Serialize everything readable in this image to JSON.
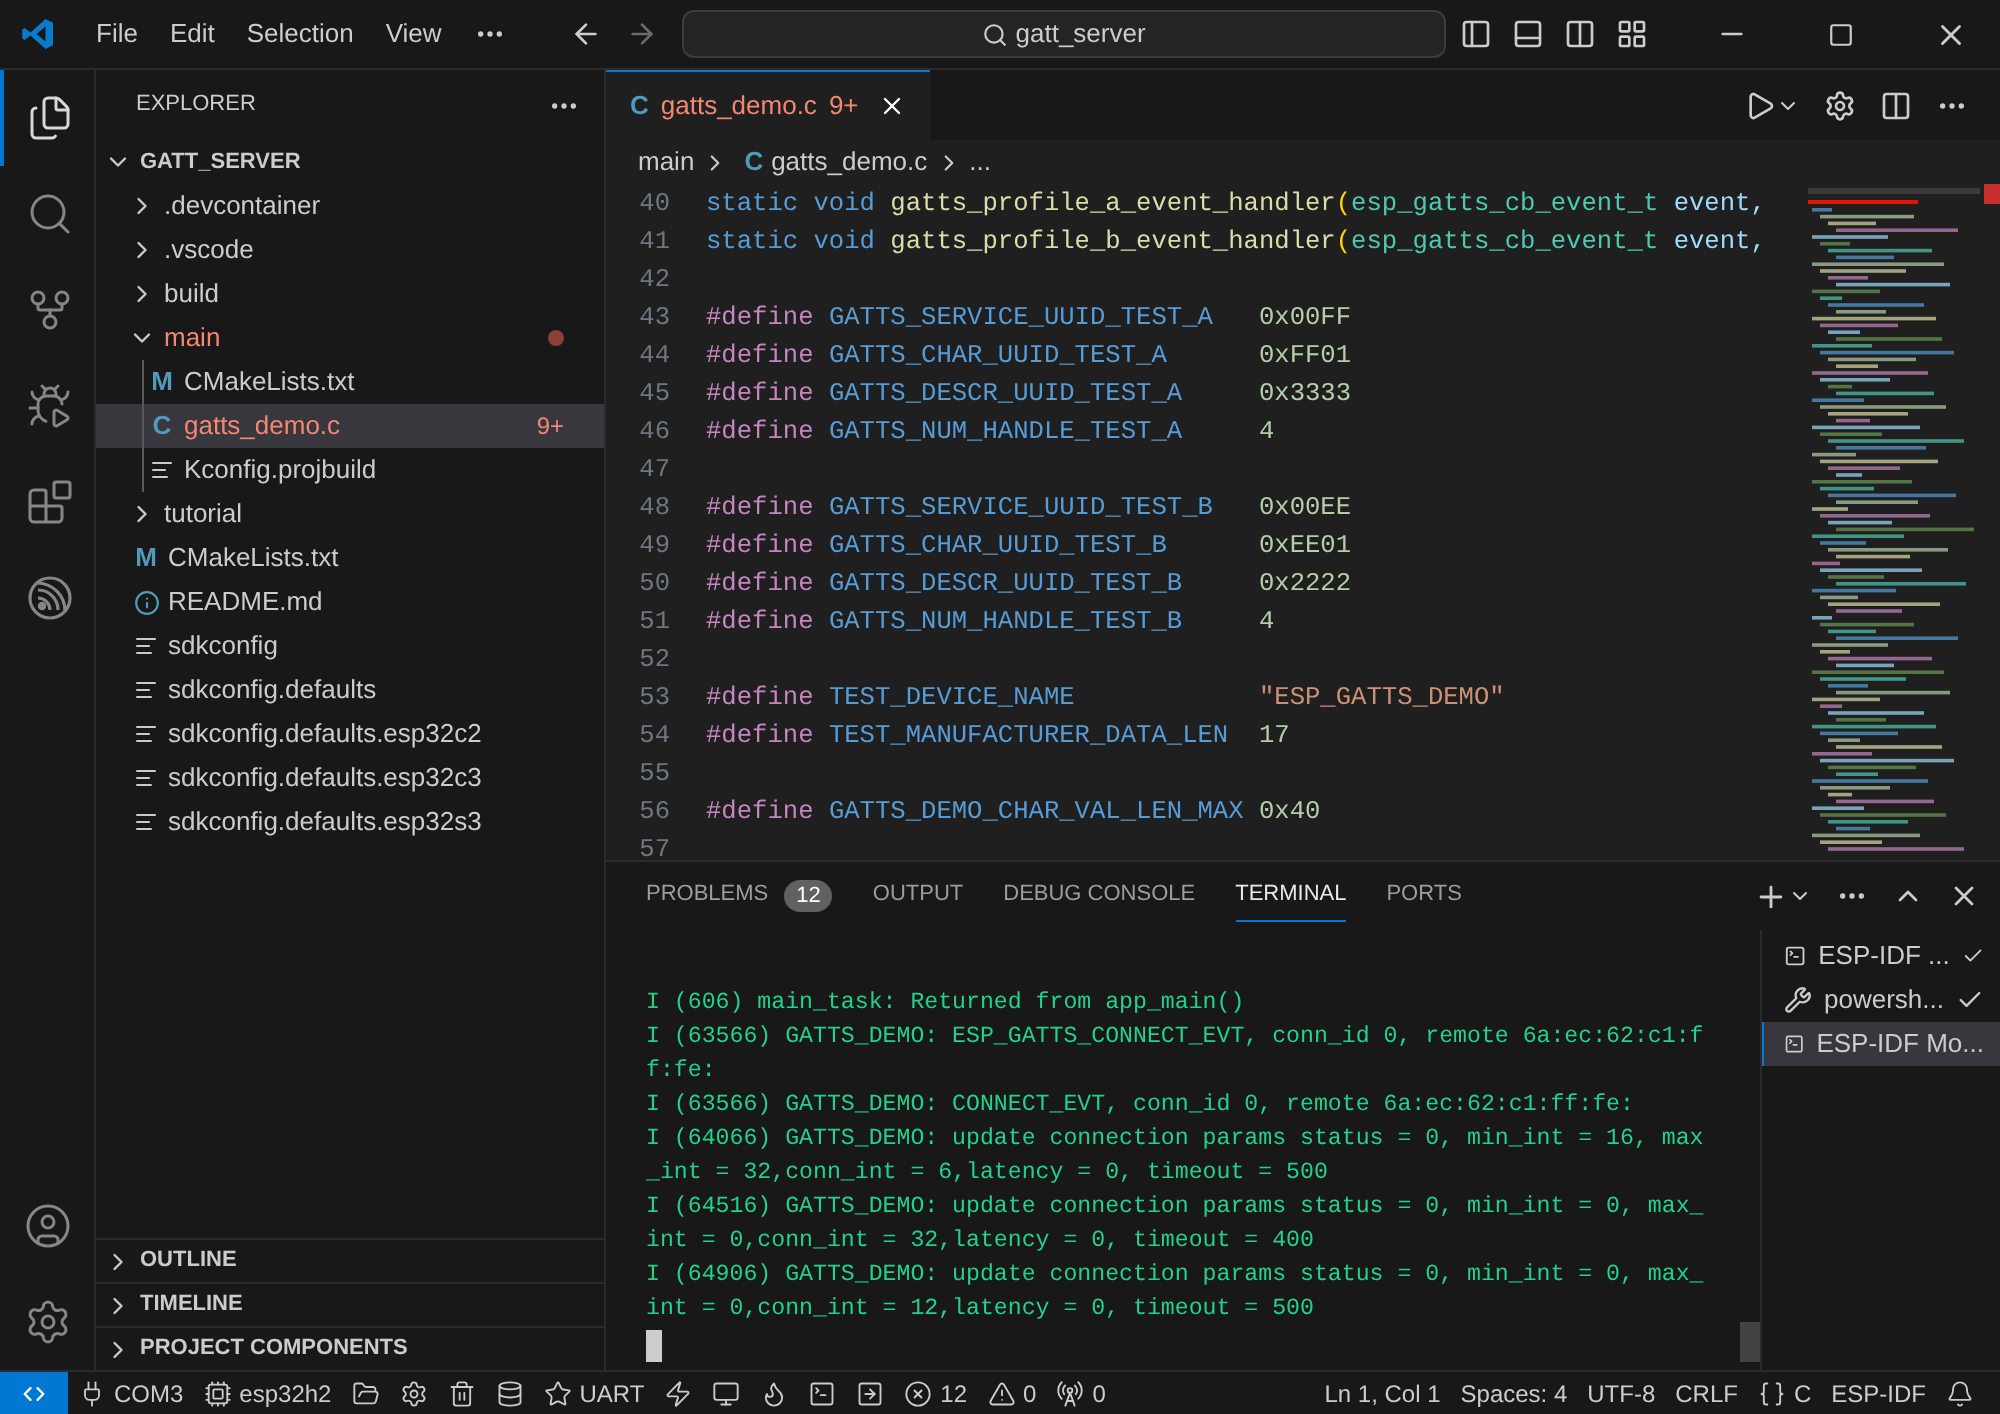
{
  "title_bar": {
    "menu": [
      "File",
      "Edit",
      "Selection",
      "View"
    ],
    "search": {
      "value": "gatt_server"
    }
  },
  "activity_bar": [
    {
      "kind": "explorer",
      "selected": true
    },
    {
      "kind": "search",
      "selected": false
    },
    {
      "kind": "source-control",
      "selected": false
    },
    {
      "kind": "run-debug",
      "selected": false
    },
    {
      "kind": "extensions",
      "selected": false
    },
    {
      "kind": "espressif",
      "selected": false
    }
  ],
  "activity_bar_bottom": [
    {
      "kind": "account"
    },
    {
      "kind": "settings"
    }
  ],
  "sidebar": {
    "title": "EXPLORER",
    "root": "GATT_SERVER",
    "tree": [
      {
        "name": ".devcontainer",
        "kind": "folder",
        "expanded": false,
        "selected": false,
        "problems": false
      },
      {
        "name": ".vscode",
        "kind": "folder",
        "expanded": false,
        "selected": false,
        "problems": false
      },
      {
        "name": "build",
        "kind": "folder",
        "expanded": false,
        "selected": false,
        "problems": false
      },
      {
        "name": "main",
        "kind": "folder",
        "expanded": true,
        "selected": false,
        "problems": true,
        "children": [
          {
            "name": "CMakeLists.txt",
            "kind": "cmake",
            "icon_text": "M",
            "selected": false,
            "problems": false
          },
          {
            "name": "gatts_demo.c",
            "kind": "c",
            "icon_text": "C",
            "selected": true,
            "problems": true,
            "badge": "9+"
          },
          {
            "name": "Kconfig.projbuild",
            "kind": "text",
            "selected": false,
            "problems": false
          }
        ]
      },
      {
        "name": "tutorial",
        "kind": "folder",
        "expanded": false,
        "selected": false,
        "problems": false
      },
      {
        "name": "CMakeLists.txt",
        "kind": "cmake",
        "icon_text": "M",
        "selected": false,
        "problems": false
      },
      {
        "name": "README.md",
        "kind": "info",
        "selected": false,
        "problems": false
      },
      {
        "name": "sdkconfig",
        "kind": "text",
        "selected": false,
        "problems": false
      },
      {
        "name": "sdkconfig.defaults",
        "kind": "text",
        "selected": false,
        "problems": false
      },
      {
        "name": "sdkconfig.defaults.esp32c2",
        "kind": "text",
        "selected": false,
        "problems": false
      },
      {
        "name": "sdkconfig.defaults.esp32c3",
        "kind": "text",
        "selected": false,
        "problems": false
      },
      {
        "name": "sdkconfig.defaults.esp32s3",
        "kind": "text",
        "selected": false,
        "problems": false
      }
    ],
    "sections": [
      {
        "title": "OUTLINE",
        "expanded": false
      },
      {
        "title": "TIMELINE",
        "expanded": false
      },
      {
        "title": "PROJECT COMPONENTS",
        "expanded": false
      }
    ]
  },
  "editor": {
    "tabs": [
      {
        "icon_text": "C",
        "title": "gatts_demo.c",
        "badge": "9+",
        "selected": true
      }
    ],
    "breadcrumb": [
      {
        "text": "main"
      },
      {
        "icon_text": "C",
        "text": "gatts_demo.c"
      },
      {
        "text": "..."
      }
    ],
    "lines": [
      {
        "number": "40",
        "tokens": [
          {
            "kind": "keyword",
            "text": "static void "
          },
          {
            "kind": "function",
            "text": "gatts_profile_a_event_handler"
          },
          {
            "kind": "paren",
            "text": "("
          },
          {
            "kind": "type",
            "text": "esp_gatts_cb_event_t"
          },
          {
            "kind": "param",
            "text": " event,"
          }
        ]
      },
      {
        "number": "41",
        "tokens": [
          {
            "kind": "keyword",
            "text": "static void "
          },
          {
            "kind": "function",
            "text": "gatts_profile_b_event_handler"
          },
          {
            "kind": "paren",
            "text": "("
          },
          {
            "kind": "type",
            "text": "esp_gatts_cb_event_t"
          },
          {
            "kind": "param",
            "text": " event,"
          }
        ]
      },
      {
        "number": "42"
      },
      {
        "number": "43",
        "tokens": [
          {
            "kind": "directive",
            "text": "#define "
          },
          {
            "kind": "macro",
            "text": "GATTS_SERVICE_UUID_TEST_A   "
          },
          {
            "kind": "number",
            "text": "0x00FF"
          }
        ]
      },
      {
        "number": "44",
        "tokens": [
          {
            "kind": "directive",
            "text": "#define "
          },
          {
            "kind": "macro",
            "text": "GATTS_CHAR_UUID_TEST_A      "
          },
          {
            "kind": "number",
            "text": "0xFF01"
          }
        ]
      },
      {
        "number": "45",
        "tokens": [
          {
            "kind": "directive",
            "text": "#define "
          },
          {
            "kind": "macro",
            "text": "GATTS_DESCR_UUID_TEST_A     "
          },
          {
            "kind": "number",
            "text": "0x3333"
          }
        ]
      },
      {
        "number": "46",
        "tokens": [
          {
            "kind": "directive",
            "text": "#define "
          },
          {
            "kind": "macro",
            "text": "GATTS_NUM_HANDLE_TEST_A     "
          },
          {
            "kind": "number",
            "text": "4"
          }
        ]
      },
      {
        "number": "47"
      },
      {
        "number": "48",
        "tokens": [
          {
            "kind": "directive",
            "text": "#define "
          },
          {
            "kind": "macro",
            "text": "GATTS_SERVICE_UUID_TEST_B   "
          },
          {
            "kind": "number",
            "text": "0x00EE"
          }
        ]
      },
      {
        "number": "49",
        "tokens": [
          {
            "kind": "directive",
            "text": "#define "
          },
          {
            "kind": "macro",
            "text": "GATTS_CHAR_UUID_TEST_B      "
          },
          {
            "kind": "number",
            "text": "0xEE01"
          }
        ]
      },
      {
        "number": "50",
        "tokens": [
          {
            "kind": "directive",
            "text": "#define "
          },
          {
            "kind": "macro",
            "text": "GATTS_DESCR_UUID_TEST_B     "
          },
          {
            "kind": "number",
            "text": "0x2222"
          }
        ]
      },
      {
        "number": "51",
        "tokens": [
          {
            "kind": "directive",
            "text": "#define "
          },
          {
            "kind": "macro",
            "text": "GATTS_NUM_HANDLE_TEST_B     "
          },
          {
            "kind": "number",
            "text": "4"
          }
        ]
      },
      {
        "number": "52"
      },
      {
        "number": "53",
        "tokens": [
          {
            "kind": "directive",
            "text": "#define "
          },
          {
            "kind": "macro",
            "text": "TEST_DEVICE_NAME            "
          },
          {
            "kind": "string",
            "text": "\"ESP_GATTS_DEMO\""
          }
        ]
      },
      {
        "number": "54",
        "tokens": [
          {
            "kind": "directive",
            "text": "#define "
          },
          {
            "kind": "macro",
            "text": "TEST_MANUFACTURER_DATA_LEN  "
          },
          {
            "kind": "number",
            "text": "17"
          }
        ]
      },
      {
        "number": "55"
      },
      {
        "number": "56",
        "tokens": [
          {
            "kind": "directive",
            "text": "#define "
          },
          {
            "kind": "macro",
            "text": "GATTS_DEMO_CHAR_VAL_LEN_MAX "
          },
          {
            "kind": "number",
            "text": "0x40"
          }
        ]
      },
      {
        "number": "57"
      }
    ]
  },
  "panel": {
    "tabs": [
      {
        "label": "PROBLEMS",
        "badge": "12",
        "selected": false
      },
      {
        "label": "OUTPUT",
        "selected": false
      },
      {
        "label": "DEBUG CONSOLE",
        "selected": false
      },
      {
        "label": "TERMINAL",
        "selected": true
      },
      {
        "label": "PORTS",
        "selected": false
      }
    ],
    "terminal_lines": [
      "I (606) main_task: Returned from app_main()",
      "I (63566) GATTS_DEMO: ESP_GATTS_CONNECT_EVT, conn_id 0, remote 6a:ec:62:c1:f",
      "f:fe:",
      "I (63566) GATTS_DEMO: CONNECT_EVT, conn_id 0, remote 6a:ec:62:c1:ff:fe:",
      "I (64066) GATTS_DEMO: update connection params status = 0, min_int = 16, max",
      "_int = 32,conn_int = 6,latency = 0, timeout = 500",
      "I (64516) GATTS_DEMO: update connection params status = 0, min_int = 0, max_",
      "int = 0,conn_int = 32,latency = 0, timeout = 400",
      "I (64906) GATTS_DEMO: update connection params status = 0, min_int = 0, max_",
      "int = 0,conn_int = 12,latency = 0, timeout = 500"
    ],
    "terminals": [
      {
        "kind": "terminal",
        "label": "ESP-IDF ...",
        "done": true,
        "selected": false
      },
      {
        "kind": "tools",
        "label": "powersh...",
        "done": true,
        "selected": false
      },
      {
        "kind": "terminal",
        "label": "ESP-IDF Mo...",
        "done": false,
        "selected": true
      }
    ]
  },
  "status_bar": {
    "left": [
      {
        "kind": "remote"
      },
      {
        "kind": "plug",
        "text": "COM3"
      },
      {
        "kind": "chip",
        "text": "esp32h2"
      },
      {
        "kind": "folder"
      },
      {
        "kind": "gear"
      },
      {
        "kind": "trash"
      },
      {
        "kind": "database"
      },
      {
        "kind": "star",
        "text": "UART"
      },
      {
        "kind": "flash"
      },
      {
        "kind": "monitor"
      },
      {
        "kind": "flame"
      },
      {
        "kind": "terminal"
      },
      {
        "kind": "enter"
      },
      {
        "kind": "errors",
        "text": "12"
      },
      {
        "kind": "warnings",
        "text": "0"
      },
      {
        "kind": "antenna",
        "text": "0"
      }
    ],
    "right": [
      {
        "kind": "text",
        "text": "Ln 1, Col 1"
      },
      {
        "kind": "text",
        "text": "Spaces: 4"
      },
      {
        "kind": "text",
        "text": "UTF-8"
      },
      {
        "kind": "text",
        "text": "CRLF"
      },
      {
        "kind": "braces",
        "text": "C"
      },
      {
        "kind": "text",
        "text": "ESP-IDF"
      },
      {
        "kind": "bell"
      }
    ]
  }
}
